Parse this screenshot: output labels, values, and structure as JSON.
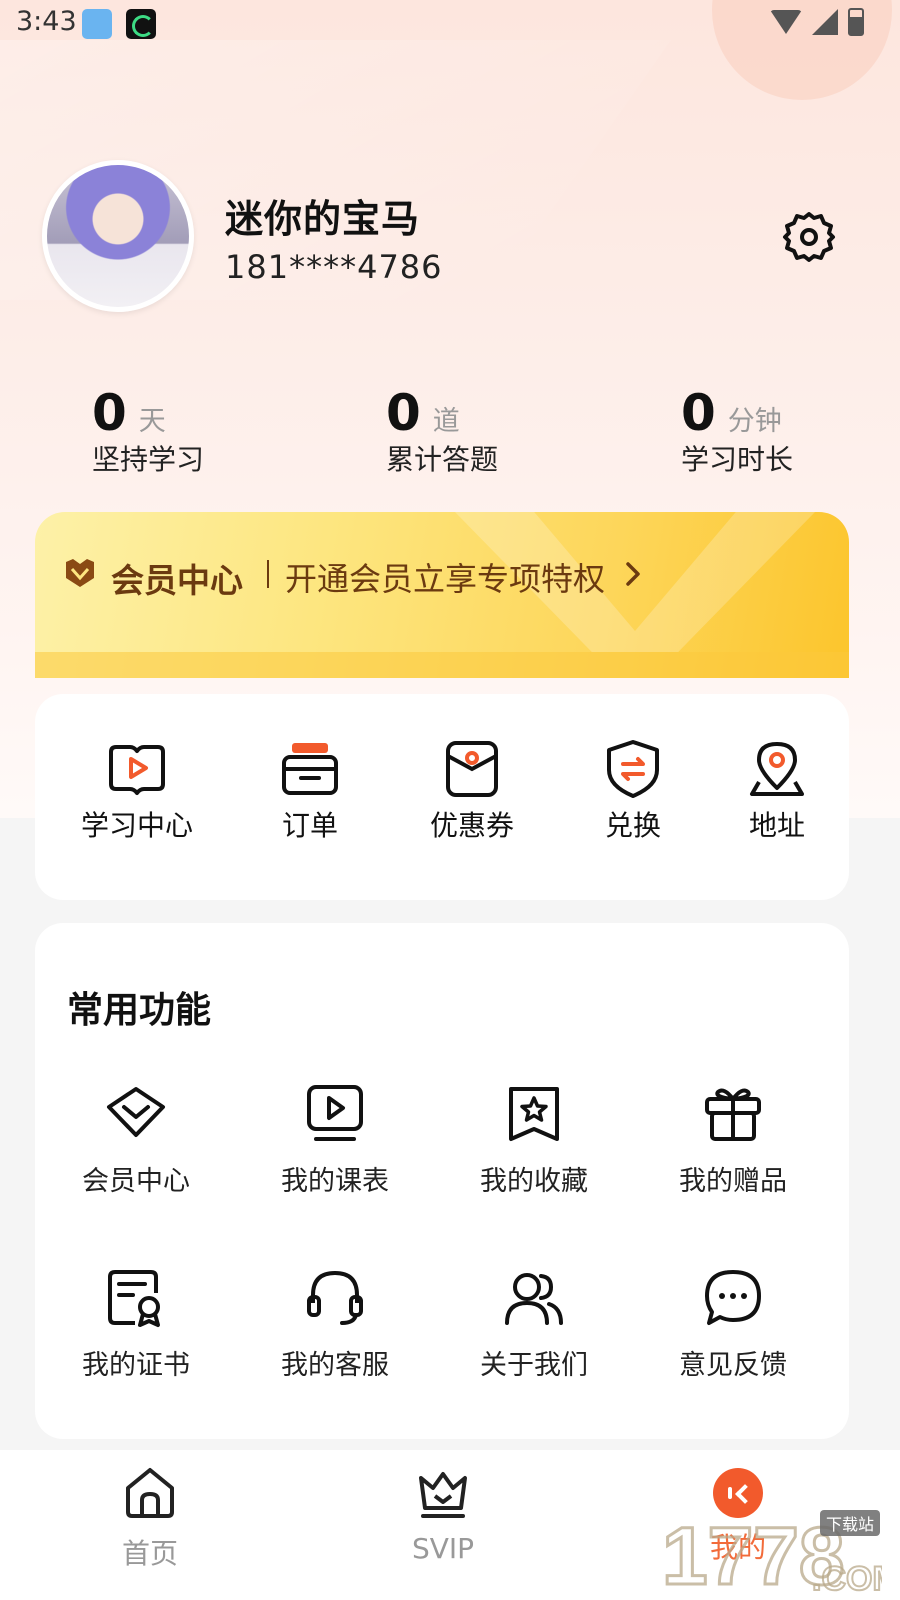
{
  "status_bar": {
    "time": "3:43",
    "icons": [
      "app-notification-icon",
      "moon-app-icon",
      "wifi-icon",
      "signal-icon",
      "battery-icon"
    ]
  },
  "profile": {
    "nickname": "迷你的宝马",
    "phone": "181****4786"
  },
  "stats": [
    {
      "value": "0",
      "unit": "天",
      "label": "坚持学习"
    },
    {
      "value": "0",
      "unit": "道",
      "label": "累计答题"
    },
    {
      "value": "0",
      "unit": "分钟",
      "label": "学习时长"
    }
  ],
  "vip_banner": {
    "title": "会员中心",
    "subtitle": "开通会员立享专项特权"
  },
  "quick_actions": [
    {
      "label": "学习中心",
      "icon": "play-book-icon"
    },
    {
      "label": "订单",
      "icon": "order-box-icon"
    },
    {
      "label": "优惠券",
      "icon": "coupon-icon"
    },
    {
      "label": "兑换",
      "icon": "exchange-shield-icon"
    },
    {
      "label": "地址",
      "icon": "location-pin-icon"
    }
  ],
  "common_functions": {
    "title": "常用功能",
    "items": [
      {
        "label": "会员中心",
        "icon": "diamond-icon"
      },
      {
        "label": "我的课表",
        "icon": "video-schedule-icon"
      },
      {
        "label": "我的收藏",
        "icon": "star-bookmark-icon"
      },
      {
        "label": "我的赠品",
        "icon": "gift-icon"
      },
      {
        "label": "我的证书",
        "icon": "certificate-icon"
      },
      {
        "label": "我的客服",
        "icon": "headset-icon"
      },
      {
        "label": "关于我们",
        "icon": "users-icon"
      },
      {
        "label": "意见反馈",
        "icon": "chat-bubble-icon"
      }
    ]
  },
  "tab_bar": {
    "tabs": [
      {
        "label": "首页",
        "icon": "home-icon",
        "active": false
      },
      {
        "label": "SVIP",
        "icon": "crown-icon",
        "active": false
      },
      {
        "label": "我的",
        "icon": "mine-icon",
        "active": true
      }
    ]
  },
  "watermark": {
    "text": "1778",
    "sub": "下载站",
    "domain": ".COM"
  },
  "colors": {
    "accent": "#f26b3a",
    "vip_text": "#6b3a10",
    "vip_gold": "#fcc52c"
  }
}
